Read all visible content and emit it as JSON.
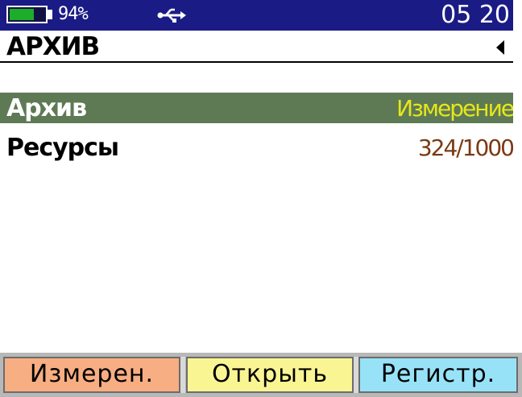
{
  "status": {
    "battery_percent_text": "94%",
    "battery_level": 0.7,
    "usb_icon": "usb-icon",
    "clock": "05 20",
    "colors": {
      "bar": "#1b1b86",
      "battery_fill": "#1cad2a"
    }
  },
  "header": {
    "title": "АРХИВ",
    "back_icon": "left-arrow-icon"
  },
  "menu": {
    "items": [
      {
        "label": "Архив",
        "value": "Измерение",
        "selected": true
      },
      {
        "label": "Ресурсы",
        "value": "324/1000",
        "selected": false
      }
    ]
  },
  "softkeys": [
    {
      "label": "Измерен.",
      "color": "#f7ae83"
    },
    {
      "label": "Открыть",
      "color": "#faf593"
    },
    {
      "label": "Регистр.",
      "color": "#98e2f7"
    }
  ]
}
